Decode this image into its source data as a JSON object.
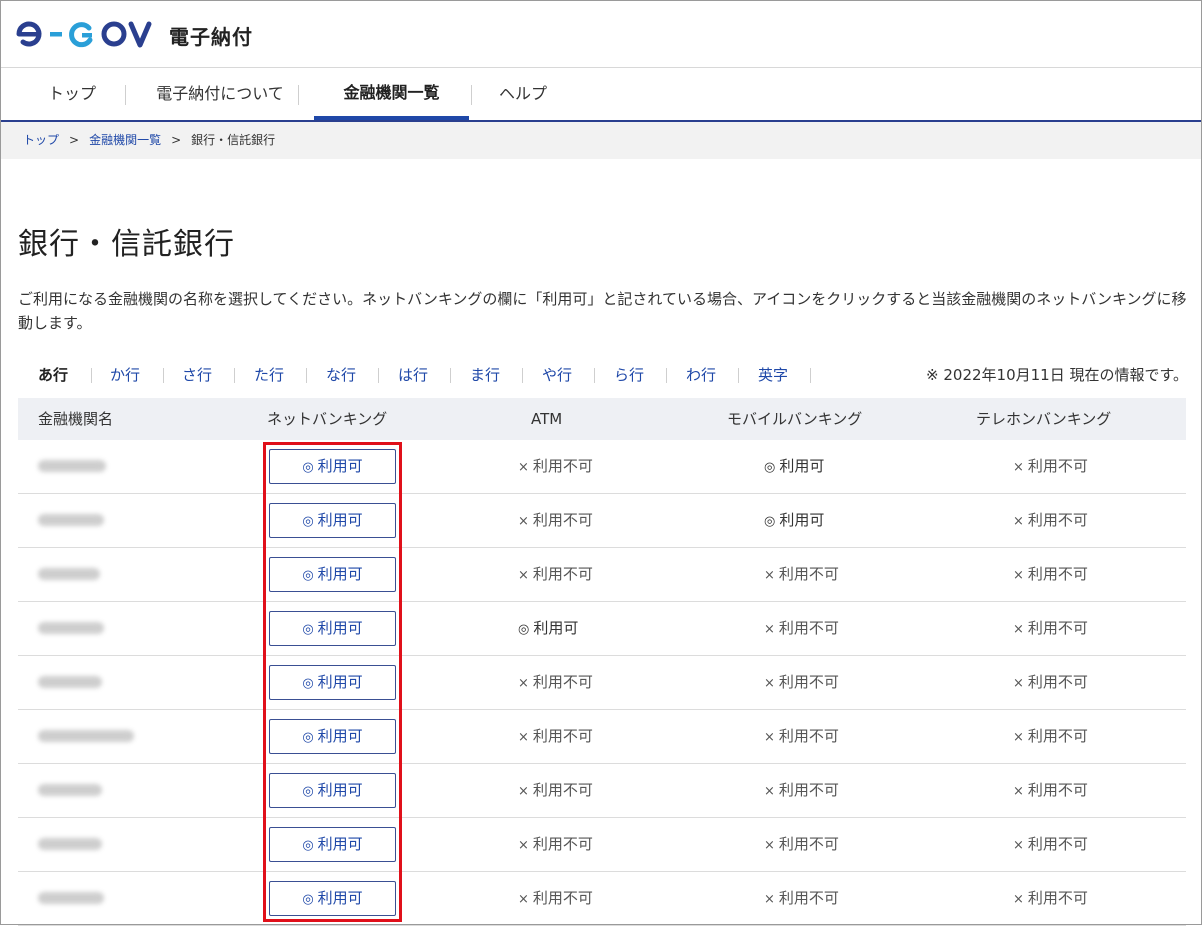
{
  "header": {
    "logo_text": "e-GOV",
    "service_name": "電子納付"
  },
  "gnav": {
    "items": [
      {
        "label": "トップ"
      },
      {
        "label": "電子納付について"
      },
      {
        "label": "金融機関一覧"
      },
      {
        "label": "ヘルプ"
      }
    ],
    "active_index": 2
  },
  "breadcrumb": {
    "items": [
      {
        "label": "トップ"
      },
      {
        "label": "金融機関一覧"
      },
      {
        "label": "銀行・信託銀行"
      }
    ],
    "separator": ">"
  },
  "page": {
    "title": "銀行・信託銀行",
    "lead": "ご利用になる金融機関の名称を選択してください。ネットバンキングの欄に「利用可」と記されている場合、アイコンをクリックすると当該金融機関のネットバンキングに移動します。"
  },
  "kana_nav": {
    "items": [
      {
        "label": "あ行"
      },
      {
        "label": "か行"
      },
      {
        "label": "さ行"
      },
      {
        "label": "た行"
      },
      {
        "label": "な行"
      },
      {
        "label": "は行"
      },
      {
        "label": "ま行"
      },
      {
        "label": "や行"
      },
      {
        "label": "ら行"
      },
      {
        "label": "わ行"
      },
      {
        "label": "英字"
      }
    ],
    "active_index": 0,
    "as_of": "※ 2022年10月11日 現在の情報です。"
  },
  "table": {
    "columns": [
      "金融機関名",
      "ネットバンキング",
      "ATM",
      "モバイルバンキング",
      "テレホンバンキング"
    ],
    "available_mark": "◎",
    "available_label": "利用可",
    "unavailable_mark": "×",
    "unavailable_label": "利用不可",
    "rows": [
      {
        "atm": "利用不可",
        "mobile": "利用可",
        "tele": "利用不可"
      },
      {
        "atm": "利用不可",
        "mobile": "利用可",
        "tele": "利用不可"
      },
      {
        "atm": "利用不可",
        "mobile": "利用不可",
        "tele": "利用不可"
      },
      {
        "atm": "利用可",
        "mobile": "利用不可",
        "tele": "利用不可"
      },
      {
        "atm": "利用不可",
        "mobile": "利用不可",
        "tele": "利用不可"
      },
      {
        "atm": "利用不可",
        "mobile": "利用不可",
        "tele": "利用不可"
      },
      {
        "atm": "利用不可",
        "mobile": "利用不可",
        "tele": "利用不可"
      },
      {
        "atm": "利用不可",
        "mobile": "利用不可",
        "tele": "利用不可"
      },
      {
        "atm": "利用不可",
        "mobile": "利用不可",
        "tele": "利用不可"
      }
    ]
  },
  "colors": {
    "brand_navy": "#2a3f8f",
    "brand_blue": "#1f48a8",
    "highlight_red": "#e0101a"
  }
}
